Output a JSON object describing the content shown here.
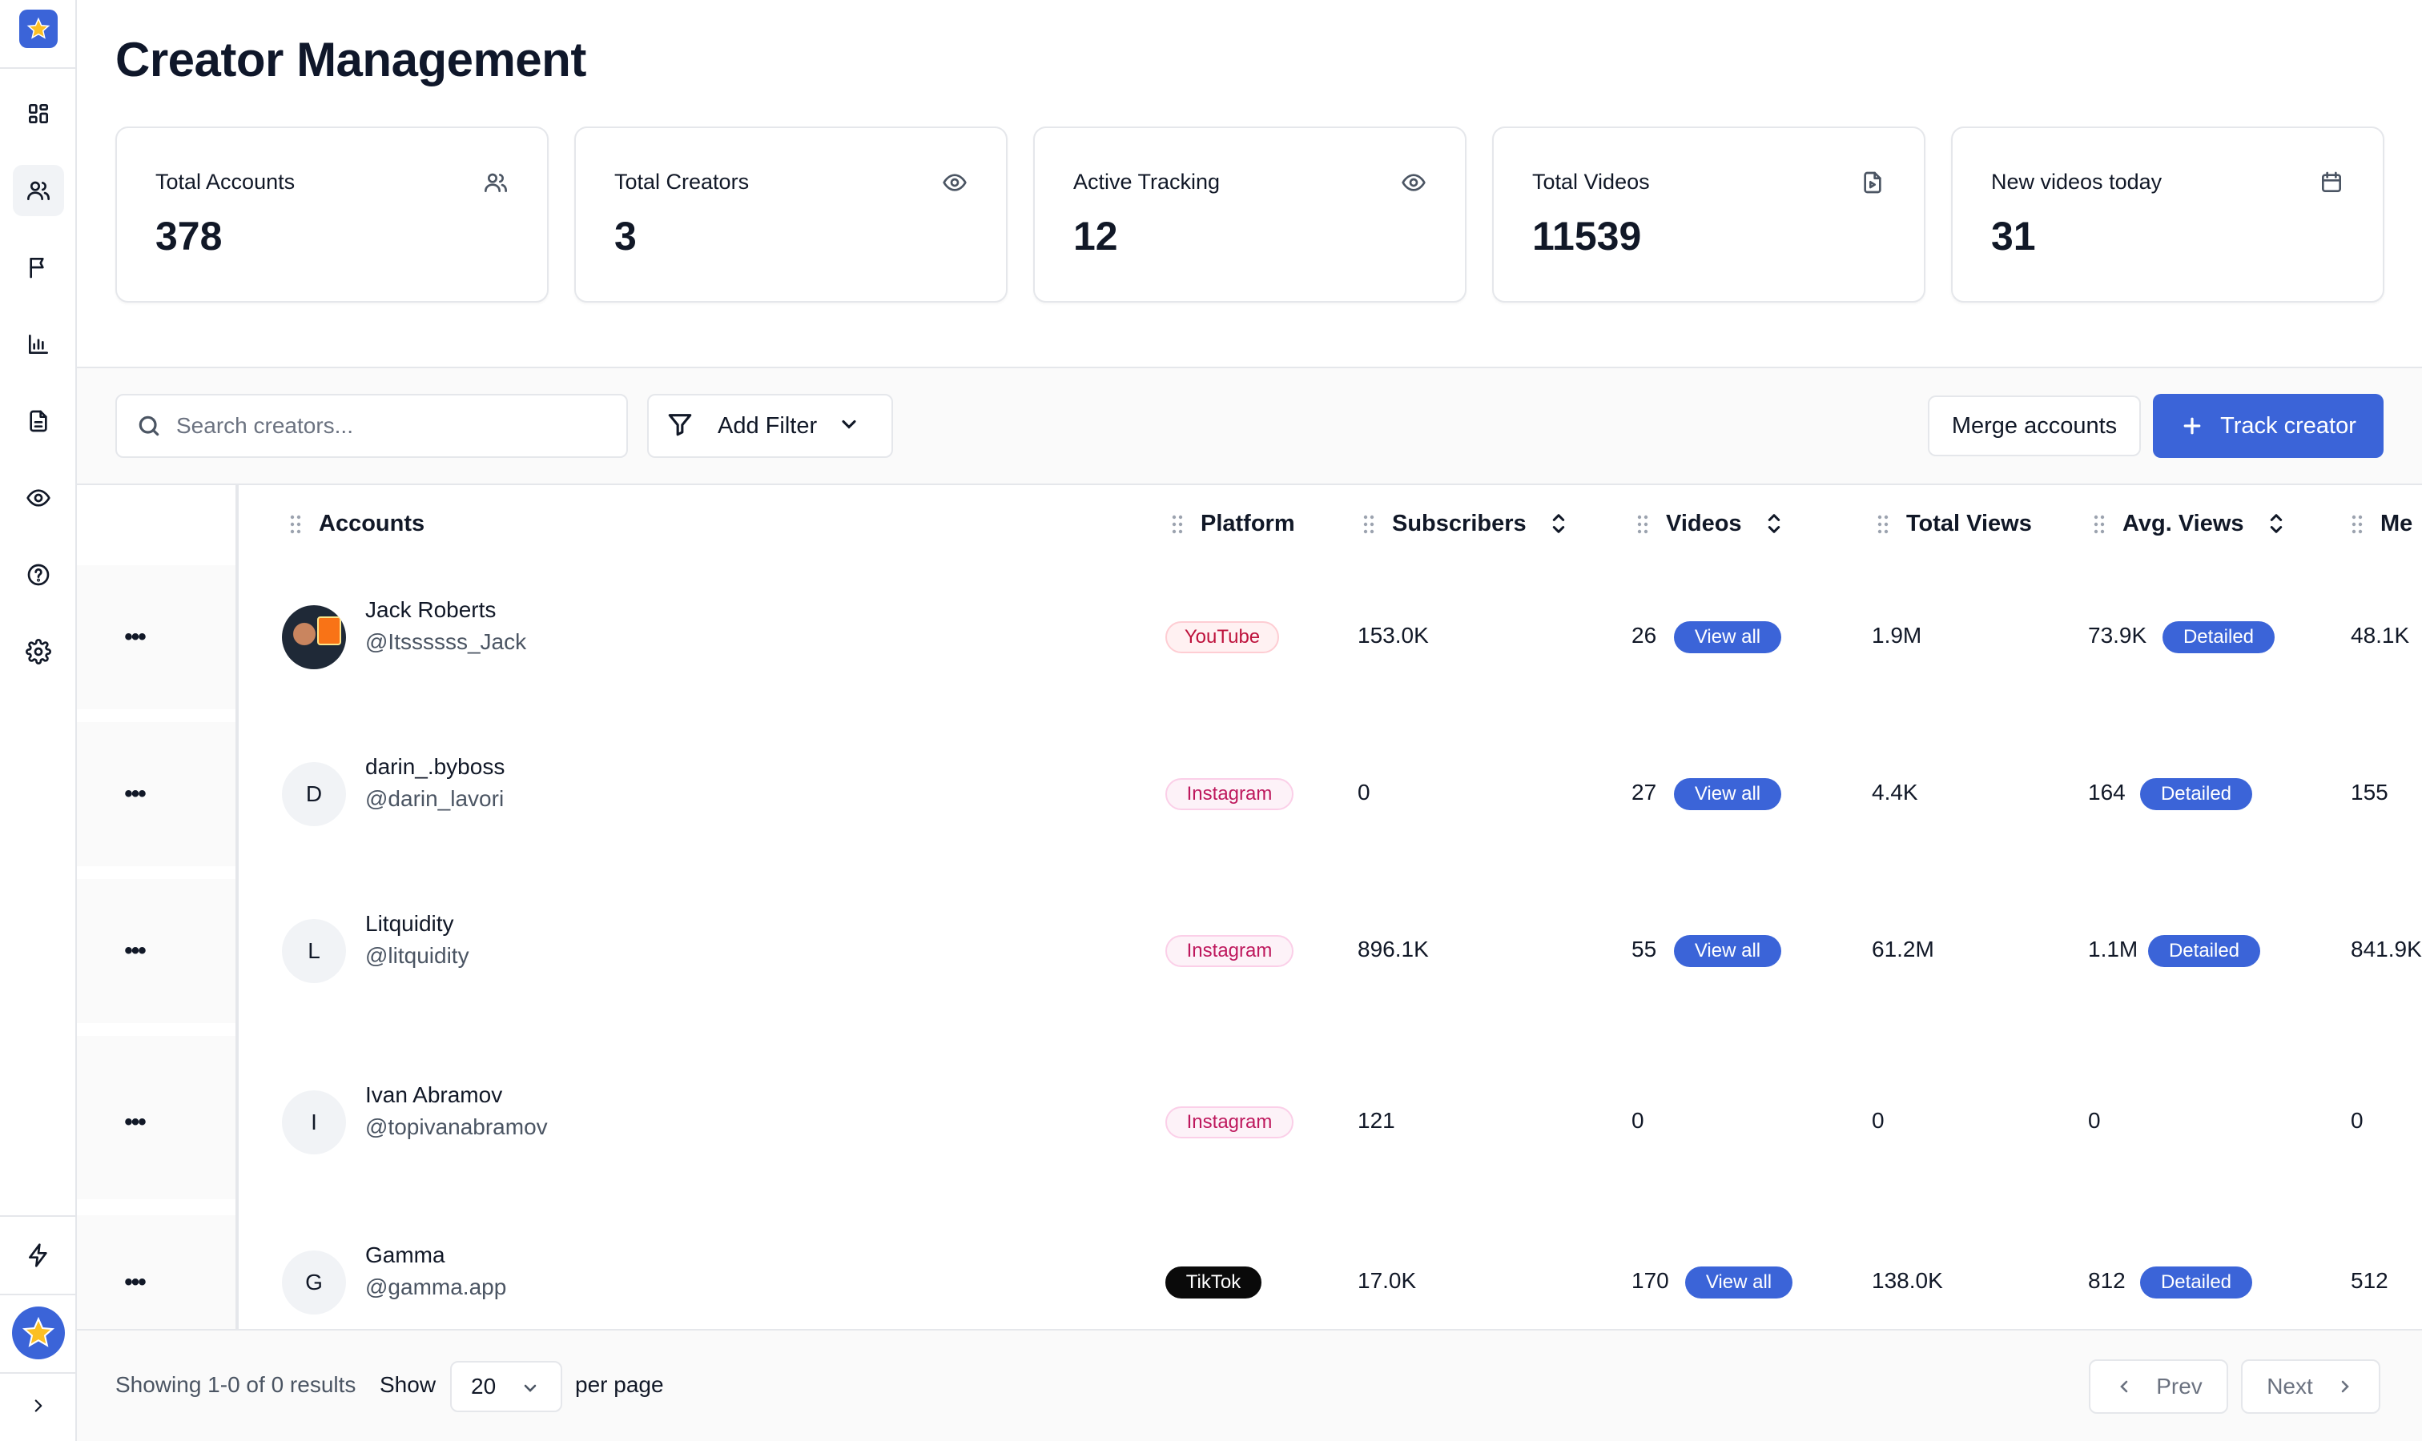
{
  "page": {
    "title": "Creator Management"
  },
  "sidebar": {
    "items": [
      {
        "name": "dashboard-icon"
      },
      {
        "name": "users-icon",
        "active": true
      },
      {
        "name": "flag-icon"
      },
      {
        "name": "bar-chart-icon"
      },
      {
        "name": "document-icon"
      },
      {
        "name": "eye-icon"
      },
      {
        "name": "help-icon"
      },
      {
        "name": "settings-icon"
      }
    ],
    "bottom": [
      {
        "name": "lightning-icon"
      },
      {
        "name": "avatar-star-icon"
      },
      {
        "name": "chevron-right-icon"
      }
    ]
  },
  "stats": [
    {
      "label": "Total Accounts",
      "value": "378",
      "icon": "users-icon"
    },
    {
      "label": "Total Creators",
      "value": "3",
      "icon": "eye-icon"
    },
    {
      "label": "Active Tracking",
      "value": "12",
      "icon": "eye-icon"
    },
    {
      "label": "Total Videos",
      "value": "11539",
      "icon": "video-file-icon"
    },
    {
      "label": "New videos today",
      "value": "31",
      "icon": "calendar-icon"
    }
  ],
  "toolbar": {
    "search_placeholder": "Search creators...",
    "filter_label": "Add Filter",
    "merge_label": "Merge accounts",
    "track_label": "Track creator"
  },
  "table": {
    "columns": [
      "Accounts",
      "Platform",
      "Subscribers",
      "Videos",
      "Total Views",
      "Avg. Views",
      "Me"
    ],
    "view_all_label": "View all",
    "detailed_label": "Detailed",
    "rows": [
      {
        "name": "Jack Roberts",
        "handle": "@Itssssss_Jack",
        "initial": "",
        "platform": "YouTube",
        "subscribers": "153.0K",
        "videos": "26",
        "total_views": "1.9M",
        "avg_views": "73.9K",
        "median": "48.1K",
        "has_links": true
      },
      {
        "name": "darin_.byboss",
        "handle": "@darin_lavori",
        "initial": "D",
        "platform": "Instagram",
        "subscribers": "0",
        "videos": "27",
        "total_views": "4.4K",
        "avg_views": "164",
        "median": "155",
        "has_links": true
      },
      {
        "name": "Litquidity",
        "handle": "@litquidity",
        "initial": "L",
        "platform": "Instagram",
        "subscribers": "896.1K",
        "videos": "55",
        "total_views": "61.2M",
        "avg_views": "1.1M",
        "median": "841.9K",
        "has_links": true
      },
      {
        "name": "Ivan Abramov",
        "handle": "@topivanabramov",
        "initial": "I",
        "platform": "Instagram",
        "subscribers": "121",
        "videos": "0",
        "total_views": "0",
        "avg_views": "0",
        "median": "0",
        "has_links": false
      },
      {
        "name": "Gamma",
        "handle": "@gamma.app",
        "initial": "G",
        "platform": "TikTok",
        "subscribers": "17.0K",
        "videos": "170",
        "total_views": "138.0K",
        "avg_views": "812",
        "median": "512",
        "has_links": true
      }
    ]
  },
  "footer": {
    "showing": "Showing 1-0 of 0 results",
    "show_label": "Show",
    "per_page_value": "20",
    "per_page_label": "per page",
    "prev_label": "Prev",
    "next_label": "Next"
  },
  "colors": {
    "accent": "#3b64d8",
    "border": "#e5e7eb",
    "muted_bg": "#fafafa"
  }
}
